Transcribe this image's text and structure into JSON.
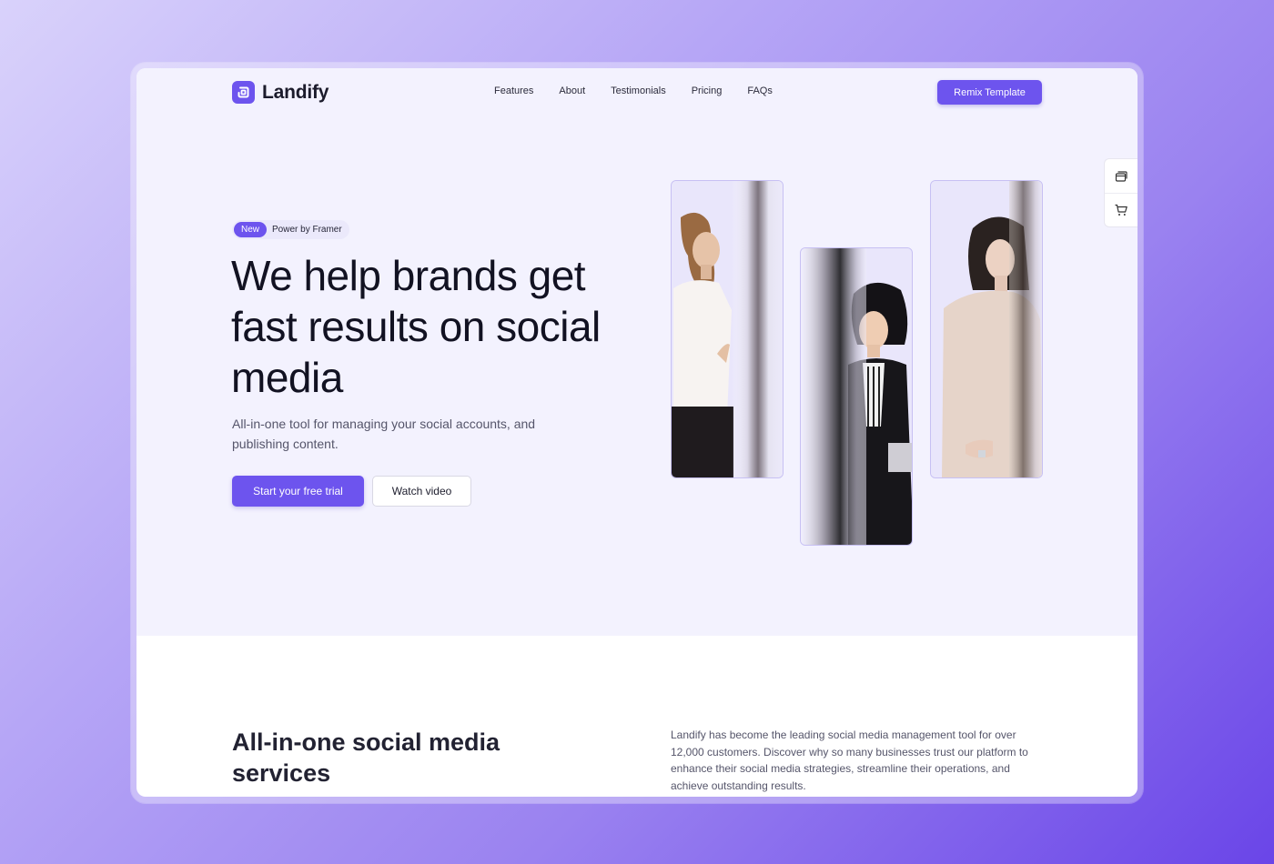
{
  "brand": {
    "name": "Landify",
    "accent": "#6d54ee"
  },
  "nav": {
    "links": [
      "Features",
      "About",
      "Testimonials",
      "Pricing",
      "FAQs"
    ],
    "cta_label": "Remix Template"
  },
  "side_widget": {
    "icons": [
      "layers-icon",
      "cart-icon"
    ]
  },
  "hero": {
    "badge_new": "New",
    "badge_text": "Power by Framer",
    "headline": "We help brands get fast results on social media",
    "subline": "All-in-one tool for managing your social accounts, and publishing content.",
    "primary_cta": "Start your free trial",
    "secondary_cta": "Watch video"
  },
  "services": {
    "title": "All-in-one social media services",
    "description": "Landify has become the leading social media management tool for over 12,000 customers. Discover why so many businesses trust our platform to enhance their social media strategies, streamline their operations, and achieve outstanding results."
  }
}
